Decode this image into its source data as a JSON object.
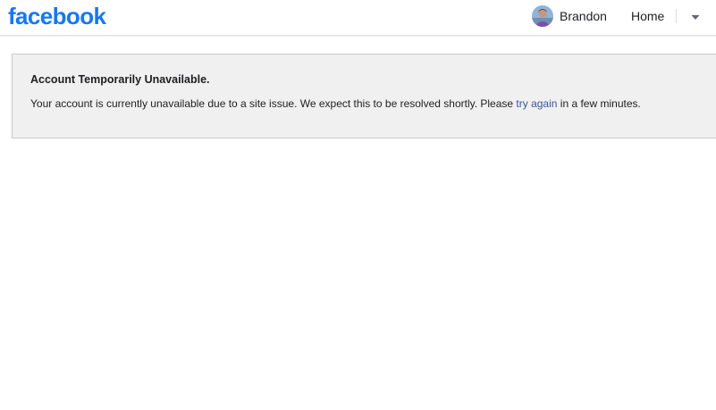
{
  "header": {
    "logo_text": "facebook",
    "profile_name": "Brandon",
    "home_label": "Home",
    "menu_icon": "caret-down-icon",
    "avatar_icon": "profile-avatar"
  },
  "notice": {
    "title": "Account Temporarily Unavailable.",
    "body_before": "Your account is currently unavailable due to a site issue. We expect this to be resolved shortly. Please ",
    "link_text": "try again",
    "body_after": " in a few minutes."
  },
  "colors": {
    "brand_blue": "#1877f2",
    "link_blue": "#385898",
    "notice_bg": "#f0f0f0",
    "notice_border": "#c9c9c9"
  }
}
